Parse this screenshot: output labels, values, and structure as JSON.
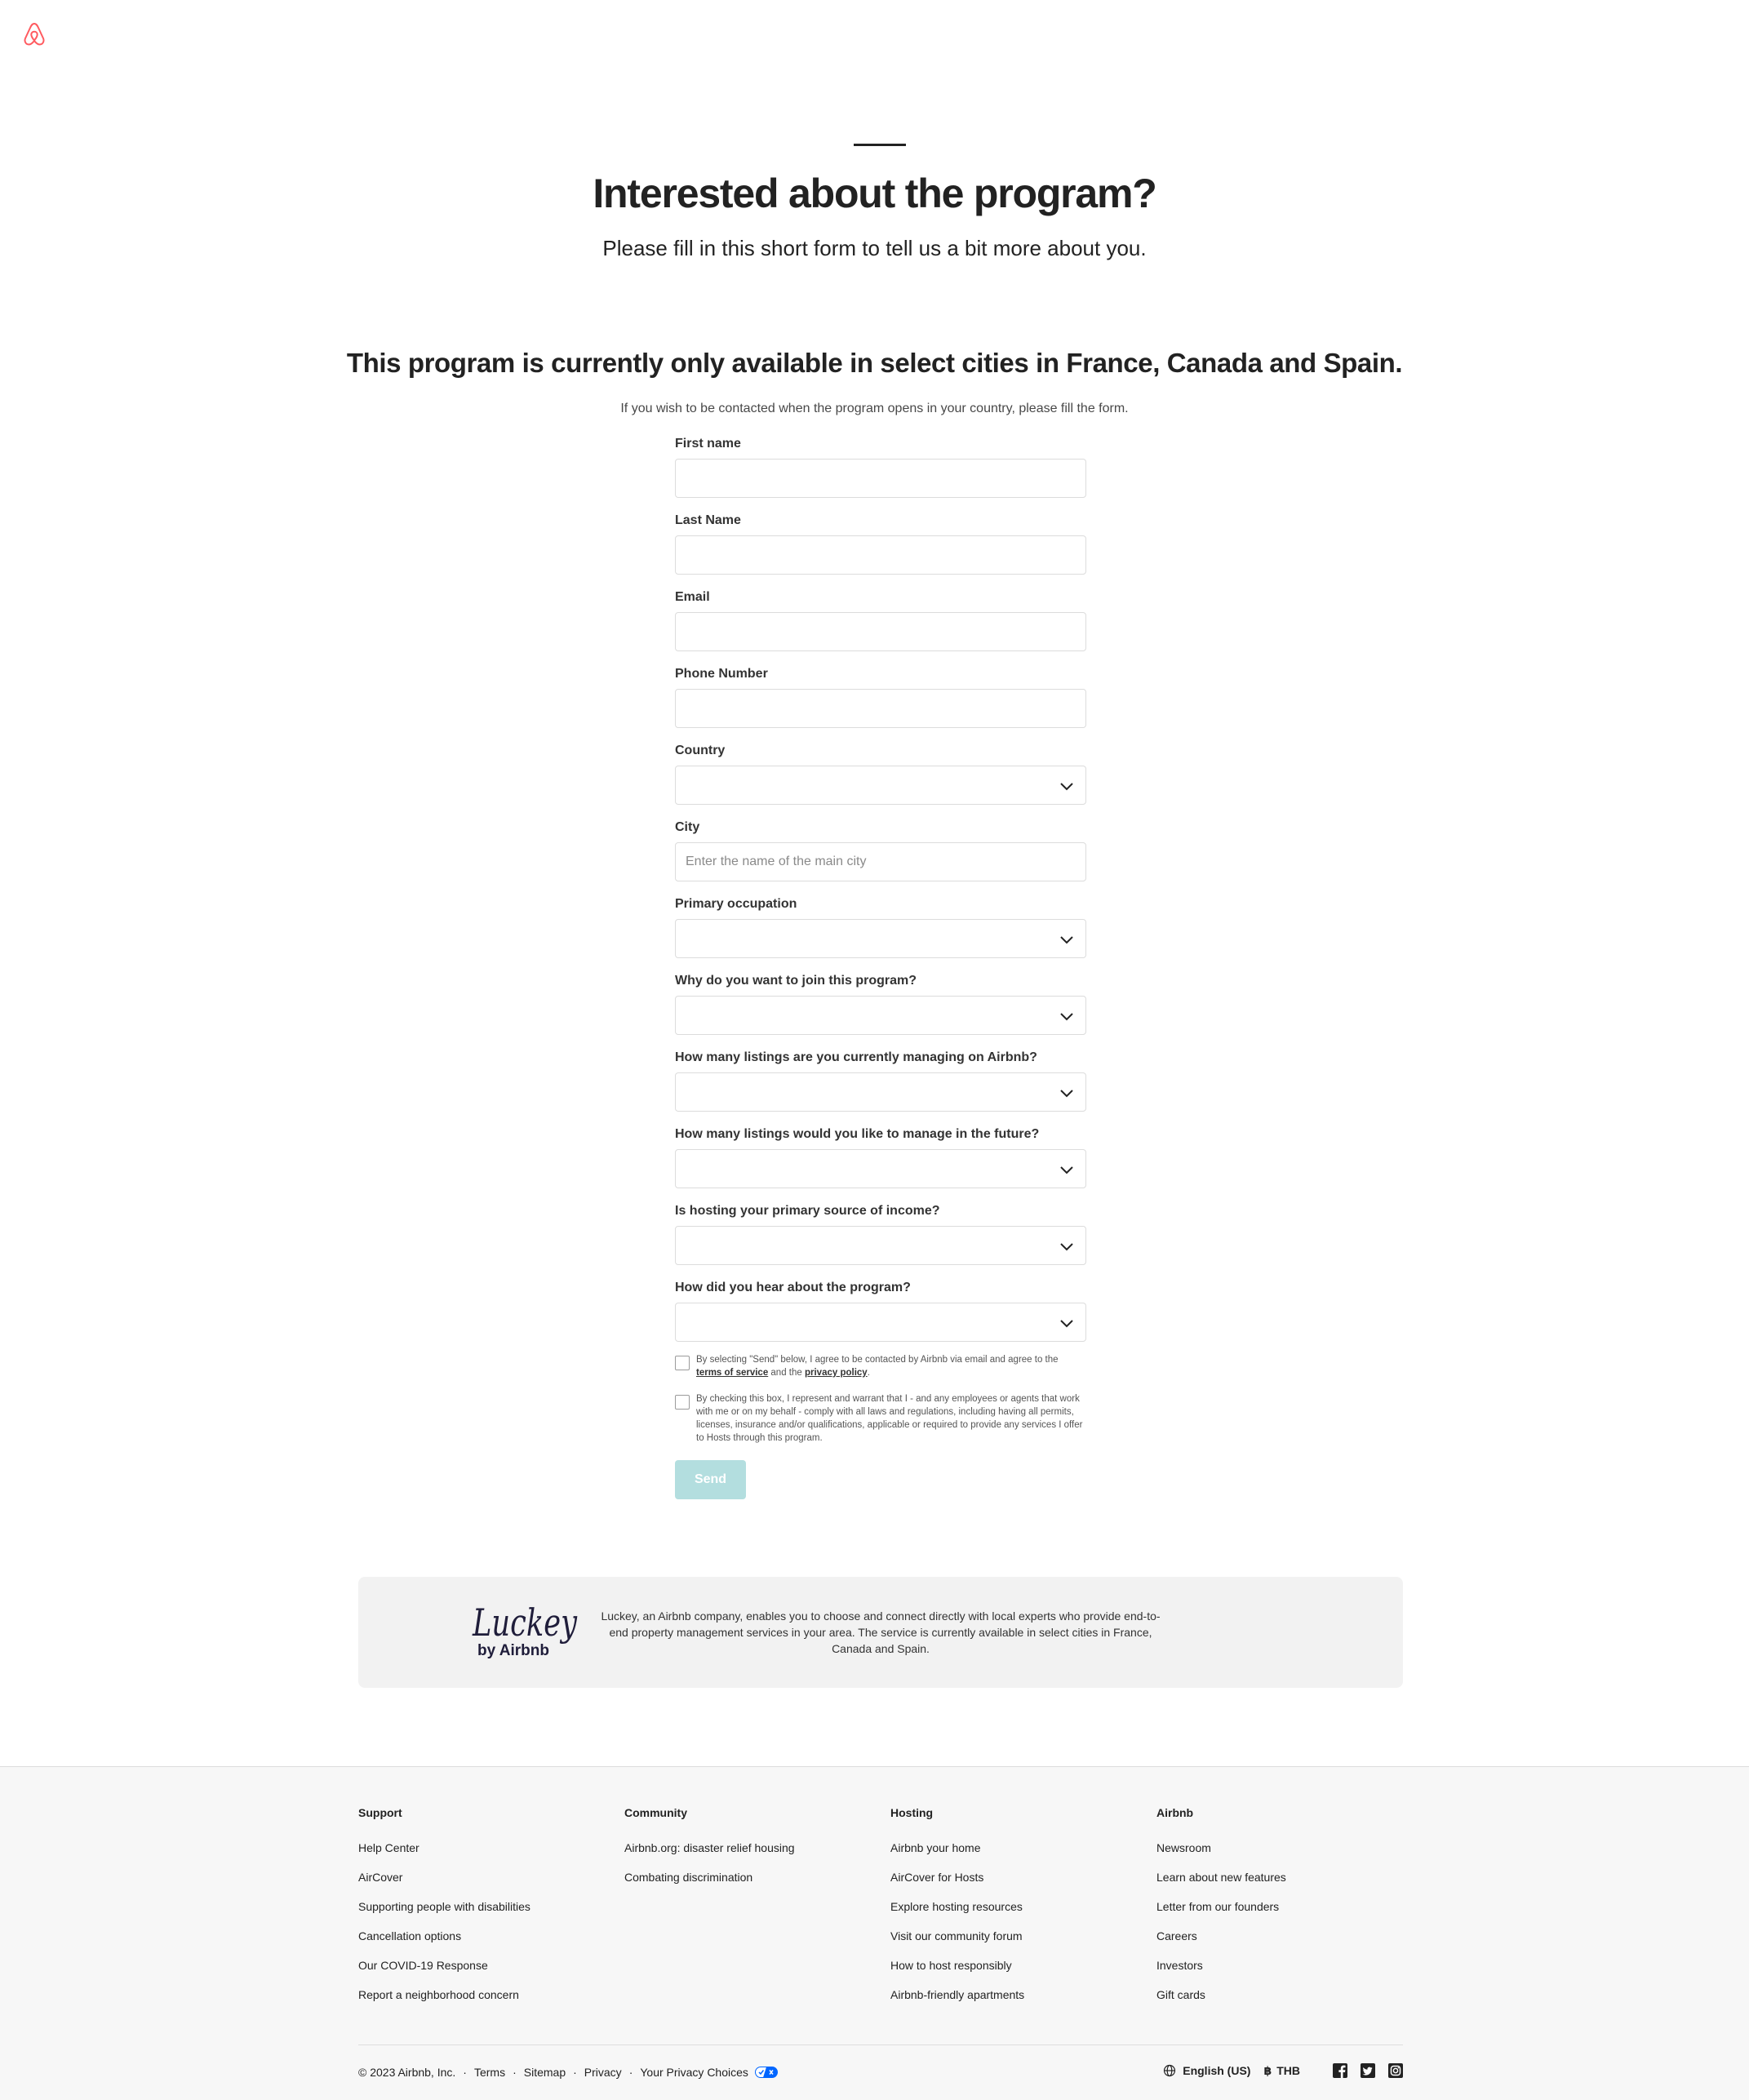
{
  "hero": {
    "title": "Interested about the program?",
    "subtitle": "Please fill in this short form to tell us a bit more about you."
  },
  "availability": {
    "title": "This program is currently only available in select cities in France, Canada and Spain.",
    "note": "If you wish to be contacted when the program opens in your country, please fill the form."
  },
  "form": {
    "fields": [
      {
        "label": "First name",
        "type": "text",
        "value": "",
        "placeholder": ""
      },
      {
        "label": "Last Name",
        "type": "text",
        "value": "",
        "placeholder": ""
      },
      {
        "label": "Email",
        "type": "text",
        "value": "",
        "placeholder": ""
      },
      {
        "label": "Phone Number",
        "type": "text",
        "value": "",
        "placeholder": ""
      },
      {
        "label": "Country",
        "type": "select",
        "value": "",
        "placeholder": ""
      },
      {
        "label": "City",
        "type": "text",
        "value": "",
        "placeholder": "Enter the name of the main city"
      },
      {
        "label": "Primary occupation",
        "type": "select",
        "value": "",
        "placeholder": ""
      },
      {
        "label": "Why do you want to join this program?",
        "type": "select",
        "value": "",
        "placeholder": ""
      },
      {
        "label": "How many listings are you currently managing on Airbnb?",
        "type": "select",
        "value": "",
        "placeholder": ""
      },
      {
        "label": "How many listings would you like to manage in the future?",
        "type": "select",
        "value": "",
        "placeholder": ""
      },
      {
        "label": "Is hosting your primary source of income?",
        "type": "select",
        "value": "",
        "placeholder": ""
      },
      {
        "label": "How did you hear about the program?",
        "type": "select",
        "value": "",
        "placeholder": ""
      }
    ],
    "consent1": {
      "before": "By selecting \"Send\" below, I agree to be contacted by Airbnb via email and agree to the ",
      "terms_link": "terms of service",
      "middle": " and the ",
      "privacy_link": "privacy policy",
      "after": ".",
      "checked": false
    },
    "consent2": {
      "text": "By checking this box, I represent and warrant that I - and any employees or agents that work with me or on my behalf - comply with all laws and regulations, including having all permits, licenses, insurance and/or qualifications, applicable or required to provide any services I offer to Hosts through this program.",
      "checked": false
    },
    "send_label": "Send"
  },
  "luckey": {
    "logo_word": "Luckey",
    "logo_by": "by Airbnb",
    "description": "Luckey, an Airbnb company, enables you to choose and connect directly with local experts who provide end-to-end property management services in your area. The service is currently available in select cities in France, Canada and Spain."
  },
  "footer": {
    "columns": [
      {
        "title": "Support",
        "links": [
          "Help Center",
          "AirCover",
          "Supporting people with disabilities",
          "Cancellation options",
          "Our COVID-19 Response",
          "Report a neighborhood concern"
        ]
      },
      {
        "title": "Community",
        "links": [
          "Airbnb.org: disaster relief housing",
          "Combating discrimination"
        ]
      },
      {
        "title": "Hosting",
        "links": [
          "Airbnb your home",
          "AirCover for Hosts",
          "Explore hosting resources",
          "Visit our community forum",
          "How to host responsibly",
          "Airbnb-friendly apartments"
        ]
      },
      {
        "title": "Airbnb",
        "links": [
          "Newsroom",
          "Learn about new features",
          "Letter from our founders",
          "Careers",
          "Investors",
          "Gift cards"
        ]
      }
    ],
    "copyright": "© 2023 Airbnb, Inc.",
    "legal_links": [
      "Terms",
      "Sitemap",
      "Privacy",
      "Your Privacy Choices"
    ],
    "language": "English (US)",
    "currency_symbol": "฿",
    "currency": "THB",
    "social_icons": [
      "facebook-icon",
      "twitter-icon",
      "instagram-icon"
    ]
  },
  "colors": {
    "brand": "#FF5A5F",
    "send_disabled": "#B3DEDF",
    "text": "#222222"
  }
}
